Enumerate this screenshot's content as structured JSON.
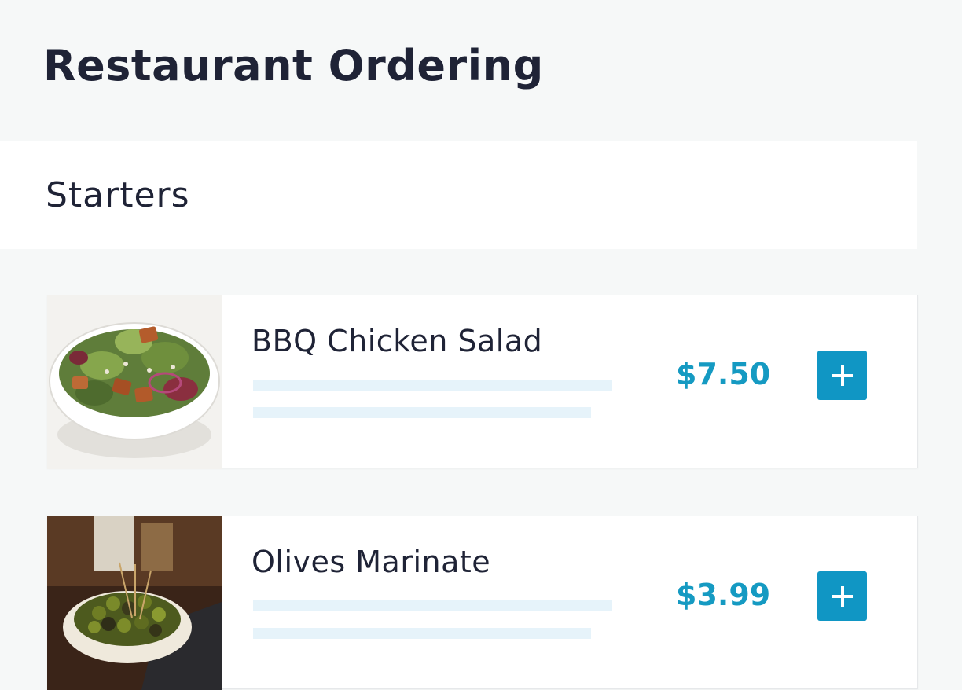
{
  "page": {
    "title": "Restaurant Ordering"
  },
  "section": {
    "title": "Starters"
  },
  "items": [
    {
      "name": "BBQ Chicken Salad",
      "price": "$7.50",
      "image": "salad-photo",
      "add_icon": "plus-icon"
    },
    {
      "name": "Olives Marinate",
      "price": "$3.99",
      "image": "olives-photo",
      "add_icon": "plus-icon"
    }
  ],
  "colors": {
    "accent": "#1096c4",
    "price": "#159ac2",
    "text": "#1f2336",
    "background": "#f6f8f8",
    "description_placeholder": "#e6f3fa"
  }
}
